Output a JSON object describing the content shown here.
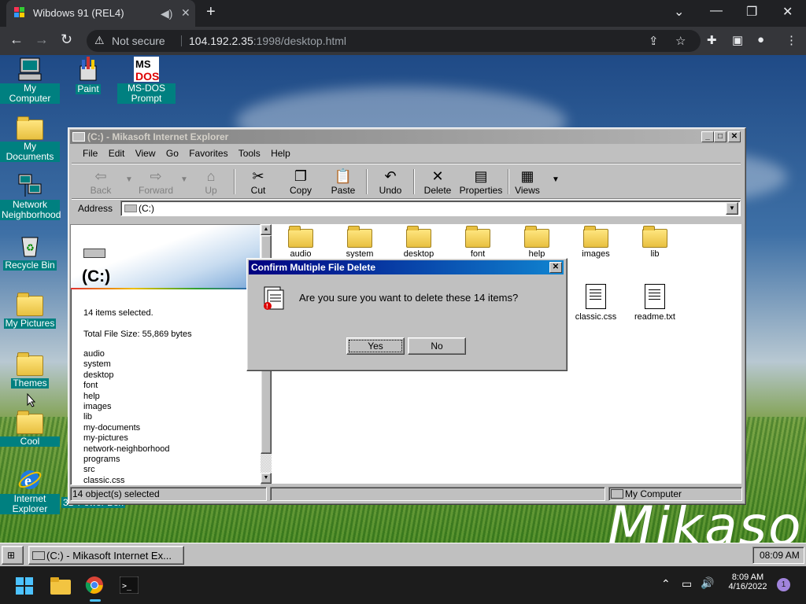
{
  "browser": {
    "tab_title": "Wibdows 91 (REL4)",
    "not_secure": "Not secure",
    "url_host": "104.192.2.35",
    "url_path": ":1998/desktop.html"
  },
  "desktop": {
    "icons": {
      "my_computer": "My Computer",
      "paint": "Paint",
      "msdos": "MS-DOS Prompt",
      "my_documents": "My Documents",
      "network": "Network Neighborhood",
      "recycle": "Recycle Bin",
      "my_pictures": "My Pictures",
      "themes": "Themes",
      "cool": "Cool",
      "ie": "Internet Explorer",
      "powerbox": "3D Power Box"
    },
    "wallpaper_text": "Mikasoft"
  },
  "explorer": {
    "title": "(C:) - Mikasoft Internet Explorer",
    "menu": [
      "File",
      "Edit",
      "View",
      "Go",
      "Favorites",
      "Tools",
      "Help"
    ],
    "toolbar": {
      "back": "Back",
      "forward": "Forward",
      "up": "Up",
      "cut": "Cut",
      "copy": "Copy",
      "paste": "Paste",
      "undo": "Undo",
      "delete": "Delete",
      "properties": "Properties",
      "views": "Views"
    },
    "address_label": "Address",
    "address_value": "(C:)",
    "left": {
      "drive": "(C:)",
      "selected": "14 items selected.",
      "size": "Total File Size: 55,869 bytes",
      "files": [
        "audio",
        "system",
        "desktop",
        "font",
        "help",
        "images",
        "lib",
        "my-documents",
        "my-pictures",
        "network-neighborhood",
        "programs",
        "src",
        "classic.css"
      ]
    },
    "items": {
      "audio": "audio",
      "system": "system",
      "desktop": "desktop",
      "font": "font",
      "help": "help",
      "images": "images",
      "lib": "lib",
      "classic": "classic.css",
      "readme": "readme.txt"
    },
    "status_left": "14 object(s) selected",
    "status_right": "My Computer"
  },
  "dialog": {
    "title": "Confirm Multiple File Delete",
    "message": "Are you sure you want to delete these 14 items?",
    "yes": "Yes",
    "no": "No"
  },
  "taskbar95": {
    "task": "(C:) - Mikasoft Internet Ex...",
    "clock": "08:09 AM"
  },
  "win11": {
    "time": "8:09 AM",
    "date": "4/16/2022",
    "badge": "1"
  }
}
